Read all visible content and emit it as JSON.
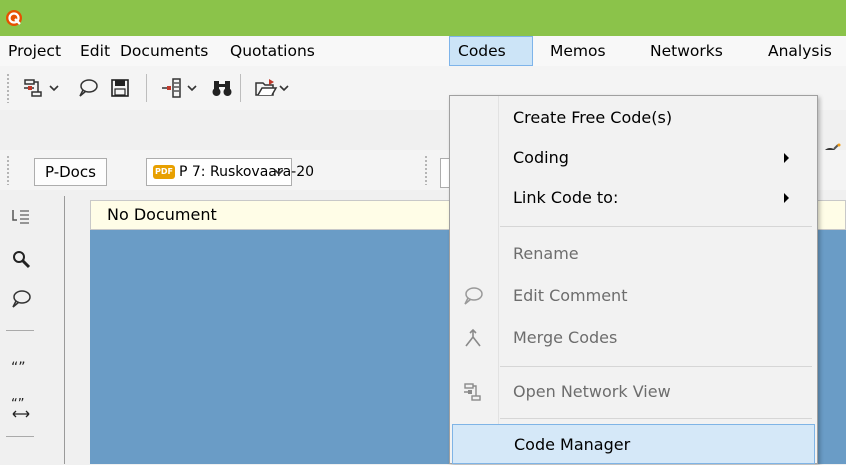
{
  "menubar": {
    "items": [
      "Project",
      "Edit",
      "Documents",
      "Quotations",
      "Codes",
      "Memos",
      "Networks",
      "Analysis"
    ],
    "active": "Codes"
  },
  "toolbar2": {
    "pdocs_label": "P-Docs",
    "doc_select_value": "P 7: Ruskovaara-20",
    "pdf_badge": "PDF"
  },
  "document": {
    "header_title": "No Document"
  },
  "codes_menu": {
    "items": [
      {
        "label": "Create Free Code(s)",
        "enabled": true,
        "submenu": false,
        "icon": ""
      },
      {
        "label": "Coding",
        "enabled": true,
        "submenu": true,
        "icon": ""
      },
      {
        "label": "Link Code to:",
        "enabled": true,
        "submenu": true,
        "icon": ""
      },
      {
        "label": "Rename",
        "enabled": false,
        "submenu": false,
        "icon": ""
      },
      {
        "label": "Edit Comment",
        "enabled": false,
        "submenu": false,
        "icon": "speech-bubble-icon"
      },
      {
        "label": "Merge Codes",
        "enabled": false,
        "submenu": false,
        "icon": "merge-icon"
      },
      {
        "label": "Open Network View",
        "enabled": false,
        "submenu": false,
        "icon": "network-view-icon"
      },
      {
        "label": "Code Manager",
        "enabled": true,
        "submenu": false,
        "icon": "",
        "highlighted": true
      }
    ]
  },
  "colors": {
    "titlebar": "#8bc34a",
    "document_area": "#6a9cc6",
    "menu_highlight": "#d5e8f8",
    "app_icon": "#e65100"
  }
}
